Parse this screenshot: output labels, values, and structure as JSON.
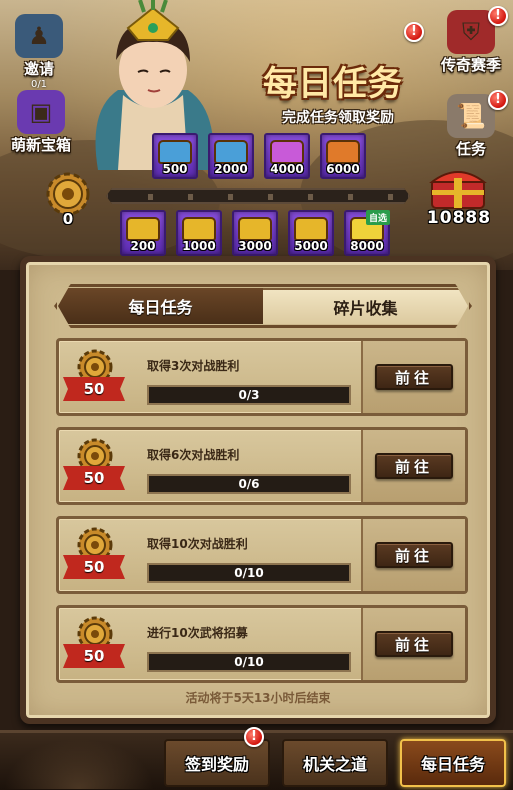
{
  "side": {
    "invite_label": "邀请",
    "invite_count": "0/1",
    "newbie_chest_label": "萌新宝箱",
    "legend_season_label": "传奇赛季",
    "tasks_label": "任务"
  },
  "header": {
    "title": "每日任务",
    "subtitle": "完成任务领取奖励",
    "gear_count": "0",
    "chest_total": "10888",
    "optional_tag": "自选"
  },
  "top_chests": [
    "500",
    "2000",
    "4000",
    "6000"
  ],
  "mid_chests": [
    "200",
    "1000",
    "3000",
    "5000",
    "8000"
  ],
  "tabs": {
    "daily": "每日任务",
    "fragments": "碎片收集"
  },
  "tasks": [
    {
      "reward": "50",
      "name": "取得3次对战胜利",
      "progress": "0/3",
      "progress_fraction": 0,
      "go_label": "前往"
    },
    {
      "reward": "50",
      "name": "取得6次对战胜利",
      "progress": "0/6",
      "progress_fraction": 0,
      "go_label": "前往"
    },
    {
      "reward": "50",
      "name": "取得10次对战胜利",
      "progress": "0/10",
      "progress_fraction": 0,
      "go_label": "前往"
    },
    {
      "reward": "50",
      "name": "进行10次武将招募",
      "progress": "0/10",
      "progress_fraction": 0,
      "go_label": "前往"
    }
  ],
  "footer_note": "活动将于5天13小时后结束",
  "bottom_tabs": {
    "signin": "签到奖励",
    "mechanism": "机关之道",
    "daily": "每日任务"
  },
  "badges": {
    "exclaim": "!"
  },
  "colors": {
    "chest_bg": "#8a4fe0",
    "ribbon": "#c0281e",
    "active_tab_border": "#f2c14a",
    "panel": "#cdb98d"
  }
}
